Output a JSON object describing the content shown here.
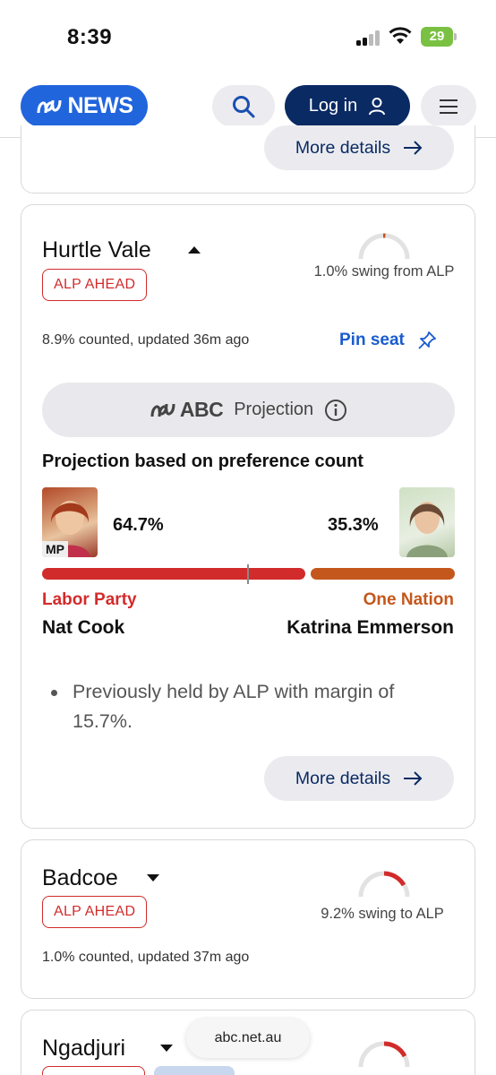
{
  "status_bar": {
    "time": "8:39",
    "battery": "29"
  },
  "header": {
    "logo_text": "NEWS",
    "login_label": "Log in"
  },
  "top_card": {
    "more_details_label": "More details"
  },
  "hurtle_vale": {
    "seat_name": "Hurtle Vale",
    "status": "ALP AHEAD",
    "swing_text": "1.0% swing from ALP",
    "counted_text": "8.9% counted, updated 36m ago",
    "pin_label": "Pin seat",
    "projection_brand": "ABC",
    "projection_label": "Projection",
    "projection_title": "Projection based on preference count",
    "left": {
      "pct": "64.7%",
      "party": "Labor Party",
      "candidate": "Nat Cook",
      "mp_tag": "MP",
      "color": "#d22b2b",
      "share": 64.7
    },
    "right": {
      "pct": "35.3%",
      "party": "One Nation",
      "candidate": "Katrina Emmerson",
      "color": "#c4571c",
      "share": 35.3
    },
    "previous": "Previously held by ALP with margin of 15.7%.",
    "more_details_label": "More details"
  },
  "badcoe": {
    "seat_name": "Badcoe",
    "status": "ALP AHEAD",
    "swing_text": "9.2% swing to ALP",
    "counted_text": "1.0% counted, updated 37m ago"
  },
  "ngadjuri": {
    "seat_name": "Ngadjuri"
  },
  "browser": {
    "url": "abc.net.au"
  },
  "colors": {
    "brand_blue": "#2165dd",
    "navy": "#0a2a63",
    "labor_red": "#d22b2b",
    "one_nation_orange": "#c4571c"
  }
}
